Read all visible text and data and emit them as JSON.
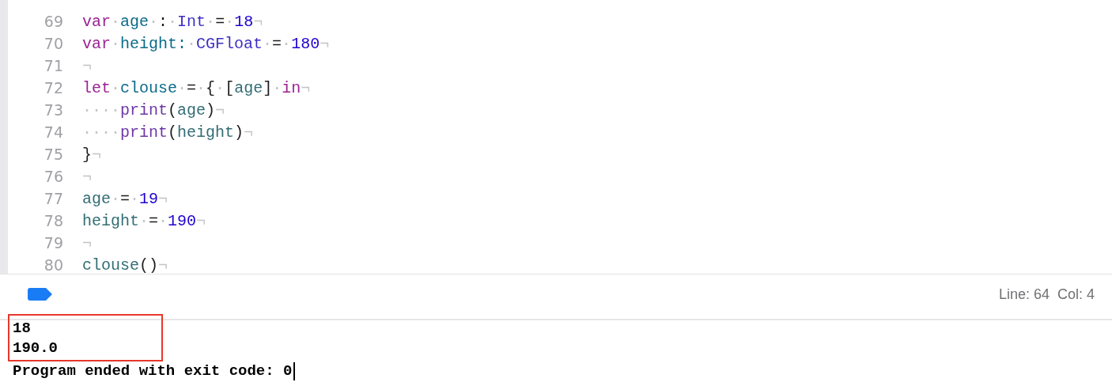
{
  "editor": {
    "lines": [
      {
        "number": "69",
        "tokens": [
          {
            "kind": "keyword",
            "text": "var"
          },
          {
            "kind": "invisible",
            "text": "·"
          },
          {
            "kind": "decl",
            "text": "age"
          },
          {
            "kind": "invisible",
            "text": "·"
          },
          {
            "kind": "plain",
            "text": ":"
          },
          {
            "kind": "invisible",
            "text": "·"
          },
          {
            "kind": "type",
            "text": "Int"
          },
          {
            "kind": "invisible",
            "text": "·"
          },
          {
            "kind": "plain",
            "text": "="
          },
          {
            "kind": "invisible",
            "text": "·"
          },
          {
            "kind": "number",
            "text": "18"
          },
          {
            "kind": "invisible",
            "text": "¬"
          }
        ]
      },
      {
        "number": "70",
        "tokens": [
          {
            "kind": "keyword",
            "text": "var"
          },
          {
            "kind": "invisible",
            "text": "·"
          },
          {
            "kind": "decl",
            "text": "height:"
          },
          {
            "kind": "invisible",
            "text": "·"
          },
          {
            "kind": "type",
            "text": "CGFloat"
          },
          {
            "kind": "invisible",
            "text": "·"
          },
          {
            "kind": "plain",
            "text": "="
          },
          {
            "kind": "invisible",
            "text": "·"
          },
          {
            "kind": "number",
            "text": "180"
          },
          {
            "kind": "invisible",
            "text": "¬"
          }
        ]
      },
      {
        "number": "71",
        "tokens": [
          {
            "kind": "invisible",
            "text": "¬"
          }
        ]
      },
      {
        "number": "72",
        "tokens": [
          {
            "kind": "keyword",
            "text": "let"
          },
          {
            "kind": "invisible",
            "text": "·"
          },
          {
            "kind": "decl",
            "text": "clouse"
          },
          {
            "kind": "invisible",
            "text": "·"
          },
          {
            "kind": "plain",
            "text": "="
          },
          {
            "kind": "invisible",
            "text": "·"
          },
          {
            "kind": "plain",
            "text": "{"
          },
          {
            "kind": "invisible",
            "text": "·"
          },
          {
            "kind": "plain",
            "text": "["
          },
          {
            "kind": "ref",
            "text": "age"
          },
          {
            "kind": "plain",
            "text": "]"
          },
          {
            "kind": "invisible",
            "text": "·"
          },
          {
            "kind": "keyword",
            "text": "in"
          },
          {
            "kind": "invisible",
            "text": "¬"
          }
        ]
      },
      {
        "number": "73",
        "tokens": [
          {
            "kind": "invisible",
            "text": "····"
          },
          {
            "kind": "func",
            "text": "print"
          },
          {
            "kind": "plain",
            "text": "("
          },
          {
            "kind": "ref",
            "text": "age"
          },
          {
            "kind": "plain",
            "text": ")"
          },
          {
            "kind": "invisible",
            "text": "¬"
          }
        ]
      },
      {
        "number": "74",
        "tokens": [
          {
            "kind": "invisible",
            "text": "····"
          },
          {
            "kind": "func",
            "text": "print"
          },
          {
            "kind": "plain",
            "text": "("
          },
          {
            "kind": "ref",
            "text": "height"
          },
          {
            "kind": "plain",
            "text": ")"
          },
          {
            "kind": "invisible",
            "text": "¬"
          }
        ]
      },
      {
        "number": "75",
        "tokens": [
          {
            "kind": "plain",
            "text": "}"
          },
          {
            "kind": "invisible",
            "text": "¬"
          }
        ]
      },
      {
        "number": "76",
        "tokens": [
          {
            "kind": "invisible",
            "text": "¬"
          }
        ]
      },
      {
        "number": "77",
        "tokens": [
          {
            "kind": "ref",
            "text": "age"
          },
          {
            "kind": "invisible",
            "text": "·"
          },
          {
            "kind": "plain",
            "text": "="
          },
          {
            "kind": "invisible",
            "text": "·"
          },
          {
            "kind": "number",
            "text": "19"
          },
          {
            "kind": "invisible",
            "text": "¬"
          }
        ]
      },
      {
        "number": "78",
        "tokens": [
          {
            "kind": "ref",
            "text": "height"
          },
          {
            "kind": "invisible",
            "text": "·"
          },
          {
            "kind": "plain",
            "text": "="
          },
          {
            "kind": "invisible",
            "text": "·"
          },
          {
            "kind": "number",
            "text": "190"
          },
          {
            "kind": "invisible",
            "text": "¬"
          }
        ]
      },
      {
        "number": "79",
        "tokens": [
          {
            "kind": "invisible",
            "text": "¬"
          }
        ]
      },
      {
        "number": "80",
        "tokens": [
          {
            "kind": "ref",
            "text": "clouse"
          },
          {
            "kind": "plain",
            "text": "()"
          },
          {
            "kind": "invisible",
            "text": "¬"
          }
        ]
      }
    ]
  },
  "debug_bar": {
    "position": "Line: 64  Col: 4"
  },
  "console": {
    "lines": [
      {
        "text": "18",
        "boxed": true
      },
      {
        "text": "190.0",
        "boxed": true
      },
      {
        "text": "Program ended with exit code: 0",
        "boxed": false
      }
    ]
  }
}
